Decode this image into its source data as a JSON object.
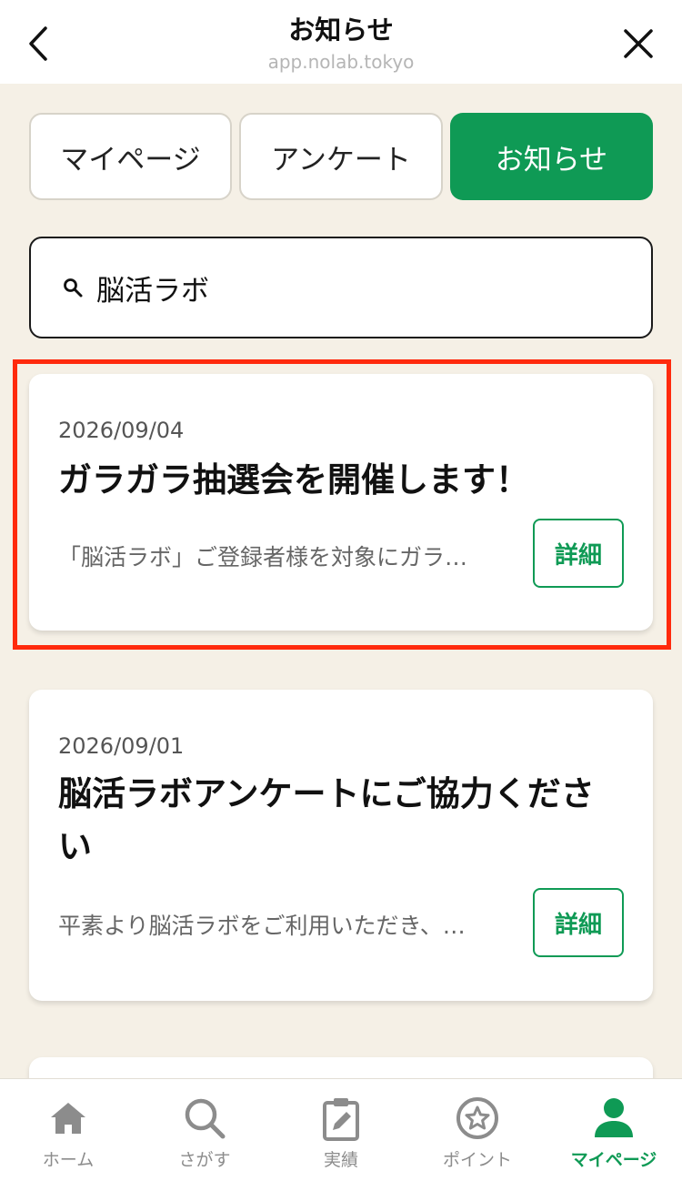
{
  "header": {
    "title": "お知らせ",
    "url": "app.nolab.tokyo"
  },
  "tabs": [
    {
      "label": "マイページ",
      "active": false
    },
    {
      "label": "アンケート",
      "active": false
    },
    {
      "label": "お知らせ",
      "active": true
    }
  ],
  "search": {
    "value": "脳活ラボ"
  },
  "notices": [
    {
      "date": "2026/09/04",
      "title": "ガラガラ抽選会を開催します！",
      "excerpt": "「脳活ラボ」ご登録者様を対象にガラ…",
      "button": "詳細"
    },
    {
      "date": "2026/09/01",
      "title": "脳活ラボアンケートにご協力ください",
      "excerpt": "平素より脳活ラボをご利用いただき、…",
      "button": "詳細"
    }
  ],
  "bottom_nav": [
    {
      "label": "ホーム",
      "icon": "home-icon",
      "active": false
    },
    {
      "label": "さがす",
      "icon": "search-icon",
      "active": false
    },
    {
      "label": "実績",
      "icon": "clipboard-edit-icon",
      "active": false
    },
    {
      "label": "ポイント",
      "icon": "point-star-icon",
      "active": false
    },
    {
      "label": "マイページ",
      "icon": "person-icon",
      "active": true
    }
  ],
  "colors": {
    "accent": "#0f9a55",
    "background": "#f5f0e6",
    "highlight": "#ff2a0d",
    "inactive_nav": "#8c8c8c"
  }
}
